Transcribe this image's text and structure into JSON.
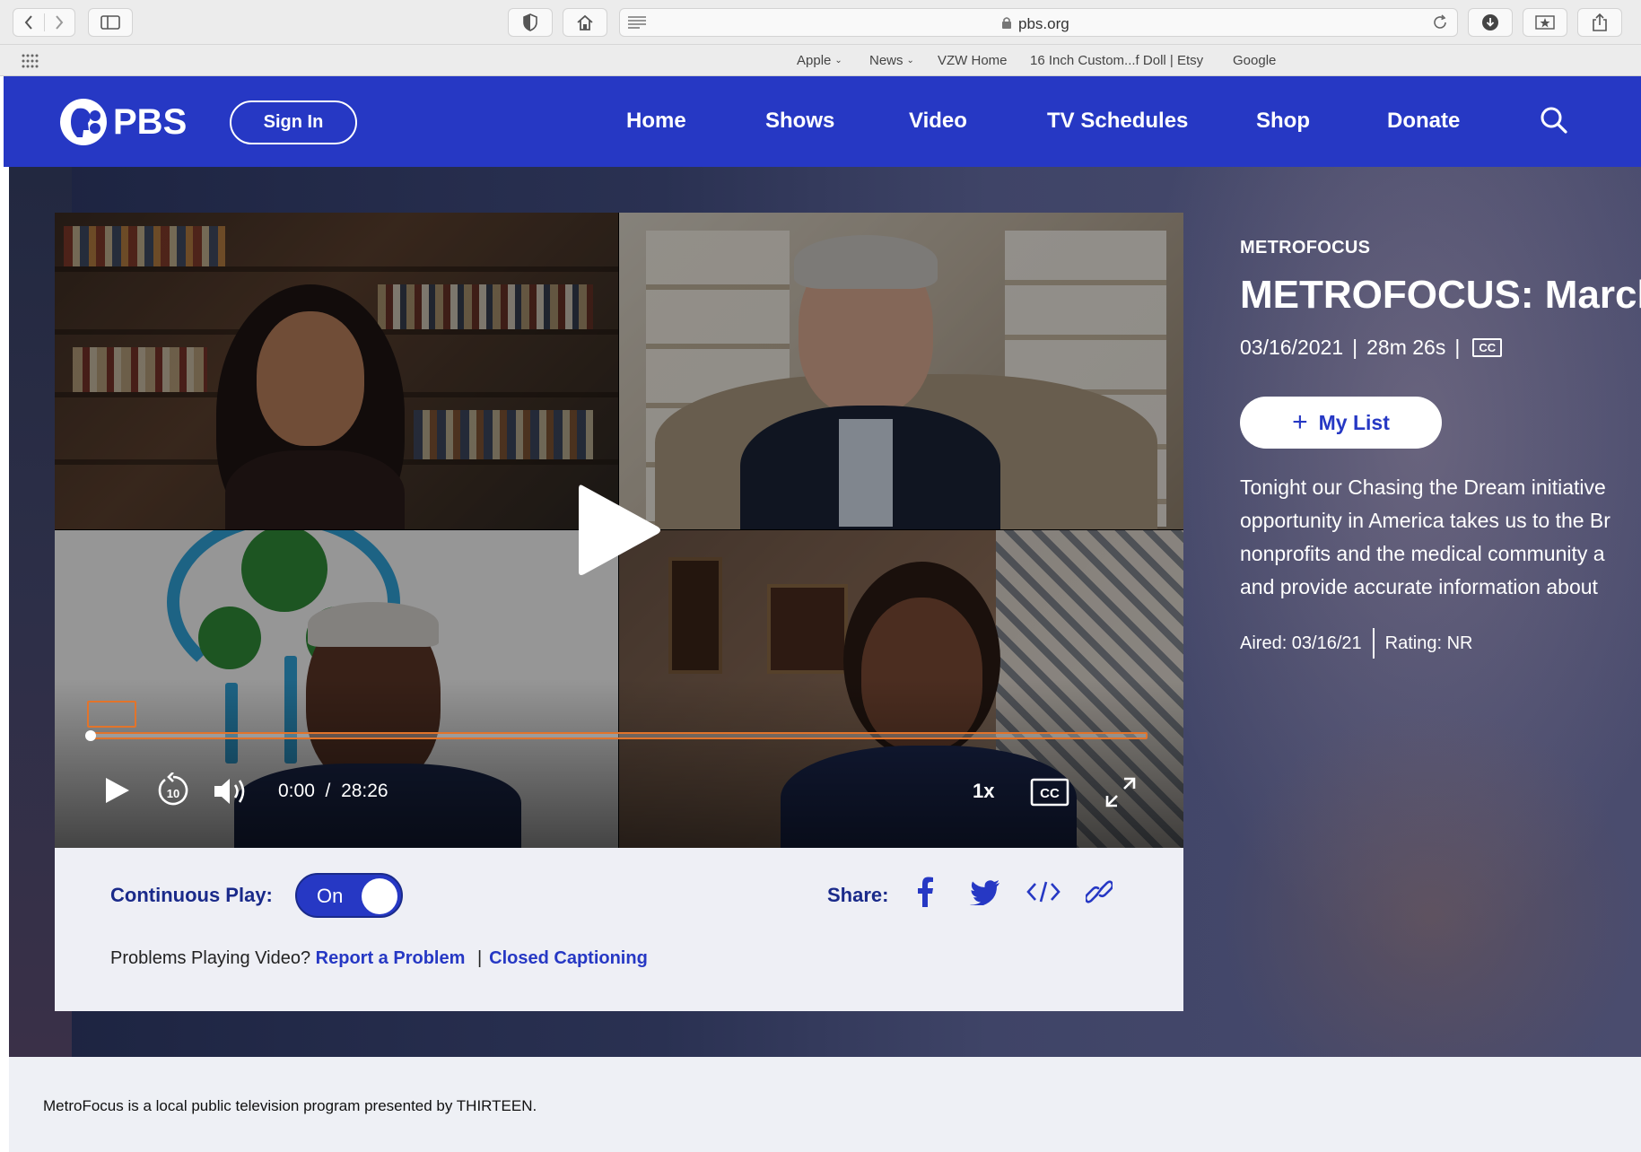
{
  "browser": {
    "url": "pbs.org",
    "favorites": [
      {
        "label": "Apple",
        "dropdown": true
      },
      {
        "label": "News",
        "dropdown": true
      },
      {
        "label": "VZW Home",
        "dropdown": false
      },
      {
        "label": "16 Inch Custom...f Doll | Etsy",
        "dropdown": false
      },
      {
        "label": "Google",
        "dropdown": false
      }
    ]
  },
  "header": {
    "logo": "PBS",
    "sign_in": "Sign In",
    "nav": [
      "Home",
      "Shows",
      "Video",
      "TV Schedules",
      "Shop",
      "Donate"
    ],
    "brand_color": "#2638c4"
  },
  "player": {
    "current_time": "0:00",
    "separator": "/",
    "duration": "28:26",
    "speed": "1x",
    "progress_fraction": 0.0,
    "accent": "#e2742b"
  },
  "panel": {
    "continuous_play_label": "Continuous Play:",
    "toggle_state": "On",
    "share_label": "Share:",
    "problems_text": "Problems Playing Video?",
    "report_link": "Report a Problem",
    "link_separator": "|",
    "cc_link": "Closed Captioning"
  },
  "episode": {
    "show": "METROFOCUS",
    "title": "METROFOCUS: March",
    "date": "03/16/2021",
    "meta_sep": "|",
    "length": "28m 26s",
    "cc_badge": "CC",
    "my_list": "My List",
    "description": [
      "Tonight our Chasing the Dream initiative",
      "opportunity in America takes us to the Br",
      "nonprofits and the medical community a",
      "and provide accurate information about"
    ],
    "aired": "Aired: 03/16/21",
    "rating": "Rating: NR"
  },
  "footer": {
    "text": "MetroFocus is a local public television program presented by THIRTEEN."
  }
}
